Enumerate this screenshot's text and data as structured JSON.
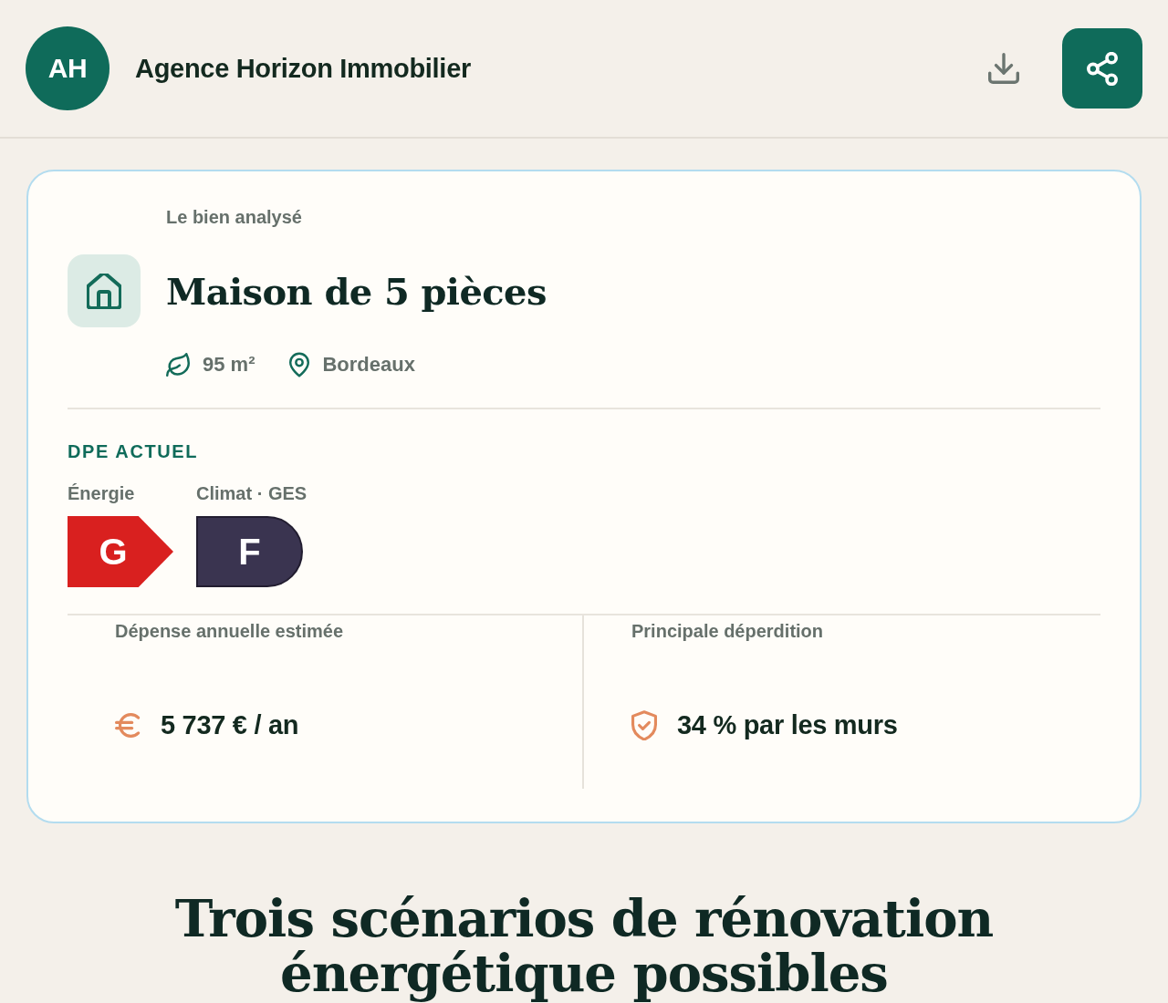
{
  "header": {
    "avatar_initials": "AH",
    "agency_name": "Agence Horizon Immobilier"
  },
  "property": {
    "eyebrow": "Le bien analysé",
    "title": "Maison de 5 pièces",
    "facts": [
      {
        "kind": "surface",
        "text": "95 m²"
      },
      {
        "kind": "location",
        "text": "Bordeaux"
      }
    ]
  },
  "dpe": {
    "heading": "DPE ACTUEL",
    "ratings": [
      {
        "kind": "energy",
        "label": "Énergie",
        "grade": "G",
        "color": "#d9201f"
      },
      {
        "kind": "climate",
        "label": "Climat · GES",
        "grade": "F",
        "color": "#3a3450"
      }
    ]
  },
  "stats": [
    {
      "kind": "cost",
      "label": "Dépense annuelle estimée",
      "value": "5 737 € / an"
    },
    {
      "kind": "loss",
      "label": "Principale déperdition",
      "value": "34 % par les murs"
    }
  ],
  "section_title": "Trois scénarios de rénovation énergétique possibles"
}
